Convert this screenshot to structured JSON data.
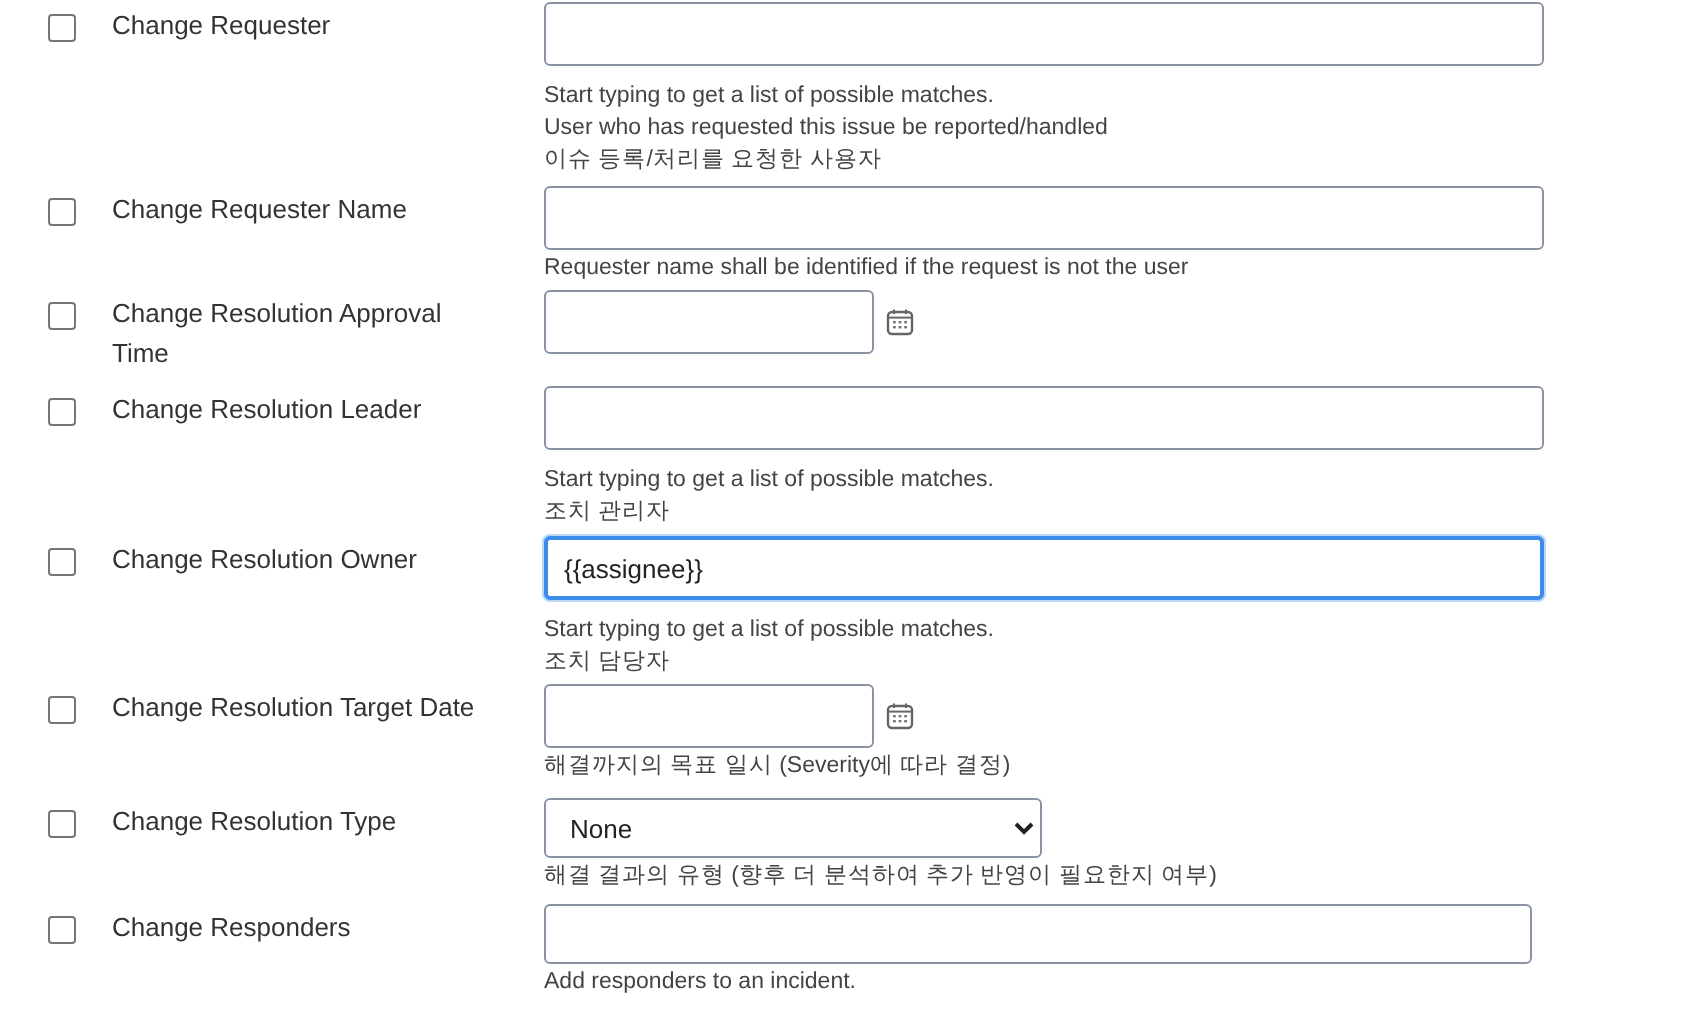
{
  "fields": [
    {
      "label": "Change Requester",
      "checked": false,
      "kind": "picker",
      "focused": false,
      "help": [
        "Start typing to get a list of possible matches.",
        "User who has requested this issue be reported/handled",
        "이슈 등록/처리를 요청한 사용자"
      ]
    },
    {
      "label": "Change Requester Name",
      "checked": false,
      "kind": "text",
      "focused": false,
      "help": [
        "Requester name shall be identified if the request is not the user"
      ]
    },
    {
      "label": "Change Resolution Approval Time",
      "checked": false,
      "kind": "date",
      "focused": false
    },
    {
      "label": "Change Resolution Leader",
      "checked": false,
      "kind": "picker",
      "focused": false,
      "help": [
        "Start typing to get a list of possible matches.",
        "조치 관리자"
      ]
    },
    {
      "label": "Change Resolution Owner",
      "checked": false,
      "kind": "picker",
      "value": "{{assignee}}",
      "focused": true,
      "help": [
        "Start typing to get a list of possible matches.",
        "조치 담당자"
      ]
    },
    {
      "label": "Change Resolution Target Date",
      "checked": false,
      "kind": "date",
      "focused": false,
      "help": [
        "해결까지의 목표 일시 (Severity에 따라 결정)"
      ]
    },
    {
      "label": "Change Resolution Type",
      "checked": false,
      "kind": "select",
      "value": "None",
      "focused": false,
      "help": [
        "해결 결과의 유형 (향후 더 분석하여 추가 반영이 필요한지 여부)"
      ]
    },
    {
      "label": "Change Responders",
      "checked": false,
      "kind": "multi",
      "focused": false,
      "help": [
        "Add responders to an incident."
      ]
    }
  ]
}
